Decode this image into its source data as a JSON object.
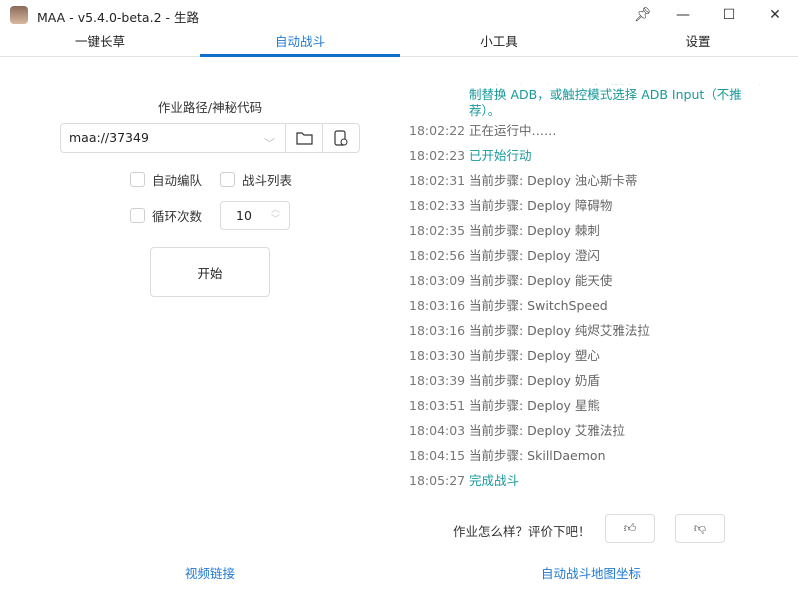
{
  "window": {
    "title": "MAA - v5.4.0-beta.2 - 生路"
  },
  "tabs": [
    {
      "label": "一键长草"
    },
    {
      "label": "自动战斗"
    },
    {
      "label": "小工具"
    },
    {
      "label": "设置"
    }
  ],
  "left": {
    "path_label": "作业路径/神秘代码",
    "path_value": "maa://37349",
    "auto_squad": "自动编队",
    "battle_list": "战斗列表",
    "loop": "循环次数",
    "loop_count": "10",
    "start": "开始",
    "video_link": "视频链接"
  },
  "log": [
    {
      "time": "18:02:22",
      "msg": "如果任务完全没有反应，请使用 设置 - 连接设置 - 强制替换 ADB，或触控模式选择 ADB Input（不推荐）。",
      "color": "teal"
    },
    {
      "time": "18:02:22",
      "msg": "正在运行中……",
      "color": "gray"
    },
    {
      "time": "18:02:23",
      "msg": "已开始行动",
      "color": "teal"
    },
    {
      "time": "18:02:31",
      "msg": "当前步骤: Deploy 浊心斯卡蒂",
      "color": "gray"
    },
    {
      "time": "18:02:33",
      "msg": "当前步骤: Deploy 障碍物",
      "color": "gray"
    },
    {
      "time": "18:02:35",
      "msg": "当前步骤: Deploy 棘刺",
      "color": "gray"
    },
    {
      "time": "18:02:56",
      "msg": "当前步骤: Deploy 澄闪",
      "color": "gray"
    },
    {
      "time": "18:03:09",
      "msg": "当前步骤: Deploy 能天使",
      "color": "gray"
    },
    {
      "time": "18:03:16",
      "msg": "当前步骤: SwitchSpeed",
      "color": "gray"
    },
    {
      "time": "18:03:16",
      "msg": "当前步骤: Deploy 纯烬艾雅法拉",
      "color": "gray"
    },
    {
      "time": "18:03:30",
      "msg": "当前步骤: Deploy 塑心",
      "color": "gray"
    },
    {
      "time": "18:03:39",
      "msg": "当前步骤: Deploy 奶盾",
      "color": "gray"
    },
    {
      "time": "18:03:51",
      "msg": "当前步骤: Deploy 星熊",
      "color": "gray"
    },
    {
      "time": "18:04:03",
      "msg": "当前步骤: Deploy 艾雅法拉",
      "color": "gray"
    },
    {
      "time": "18:04:15",
      "msg": "当前步骤: SkillDaemon",
      "color": "gray"
    },
    {
      "time": "18:05:27",
      "msg": "完成战斗",
      "color": "teal"
    }
  ],
  "feedback": {
    "prompt": "作业怎么样？评价下吧！",
    "map_link": "自动战斗地图坐标"
  },
  "colors": {
    "accent": "#0e72cc",
    "teal": "#17999a",
    "link": "#1f7ad3"
  }
}
